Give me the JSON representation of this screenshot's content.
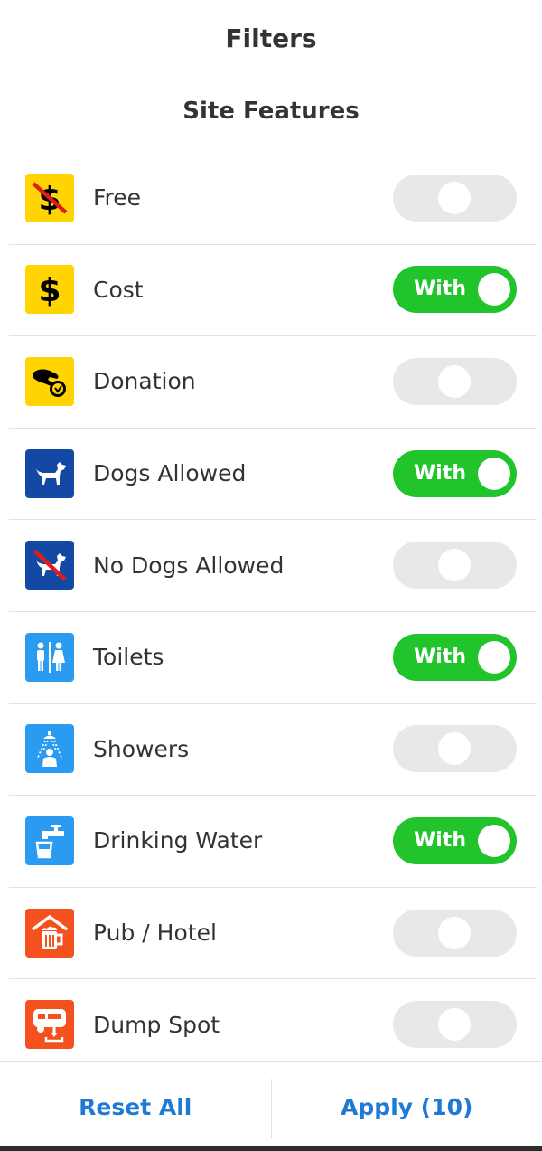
{
  "header": {
    "title": "Filters"
  },
  "section": {
    "title": "Site Features"
  },
  "items": [
    {
      "label": "Free",
      "icon": "no-cost-icon",
      "enabled": false,
      "toggle_label": ""
    },
    {
      "label": "Cost",
      "icon": "dollar-icon",
      "enabled": true,
      "toggle_label": "With"
    },
    {
      "label": "Donation",
      "icon": "donation-hand-icon",
      "enabled": false,
      "toggle_label": ""
    },
    {
      "label": "Dogs Allowed",
      "icon": "dog-icon",
      "enabled": true,
      "toggle_label": "With"
    },
    {
      "label": "No Dogs Allowed",
      "icon": "no-dogs-icon",
      "enabled": false,
      "toggle_label": ""
    },
    {
      "label": "Toilets",
      "icon": "toilets-icon",
      "enabled": true,
      "toggle_label": "With"
    },
    {
      "label": "Showers",
      "icon": "shower-icon",
      "enabled": false,
      "toggle_label": ""
    },
    {
      "label": "Drinking Water",
      "icon": "drinking-water-icon",
      "enabled": true,
      "toggle_label": "With"
    },
    {
      "label": "Pub / Hotel",
      "icon": "pub-icon",
      "enabled": false,
      "toggle_label": ""
    },
    {
      "label": "Dump Spot",
      "icon": "dump-spot-icon",
      "enabled": false,
      "toggle_label": ""
    }
  ],
  "footer": {
    "reset_label": "Reset All",
    "apply_label": "Apply (10)"
  },
  "colors": {
    "toggle_on": "#21c42a",
    "toggle_off": "#e8e8e8",
    "cost_icon_bg": "#ffd400",
    "dog_icon_bg": "#1348a4",
    "amenity_icon_bg": "#2a9bf0",
    "service_icon_bg": "#f4511e",
    "action_blue": "#1f7ad6"
  }
}
